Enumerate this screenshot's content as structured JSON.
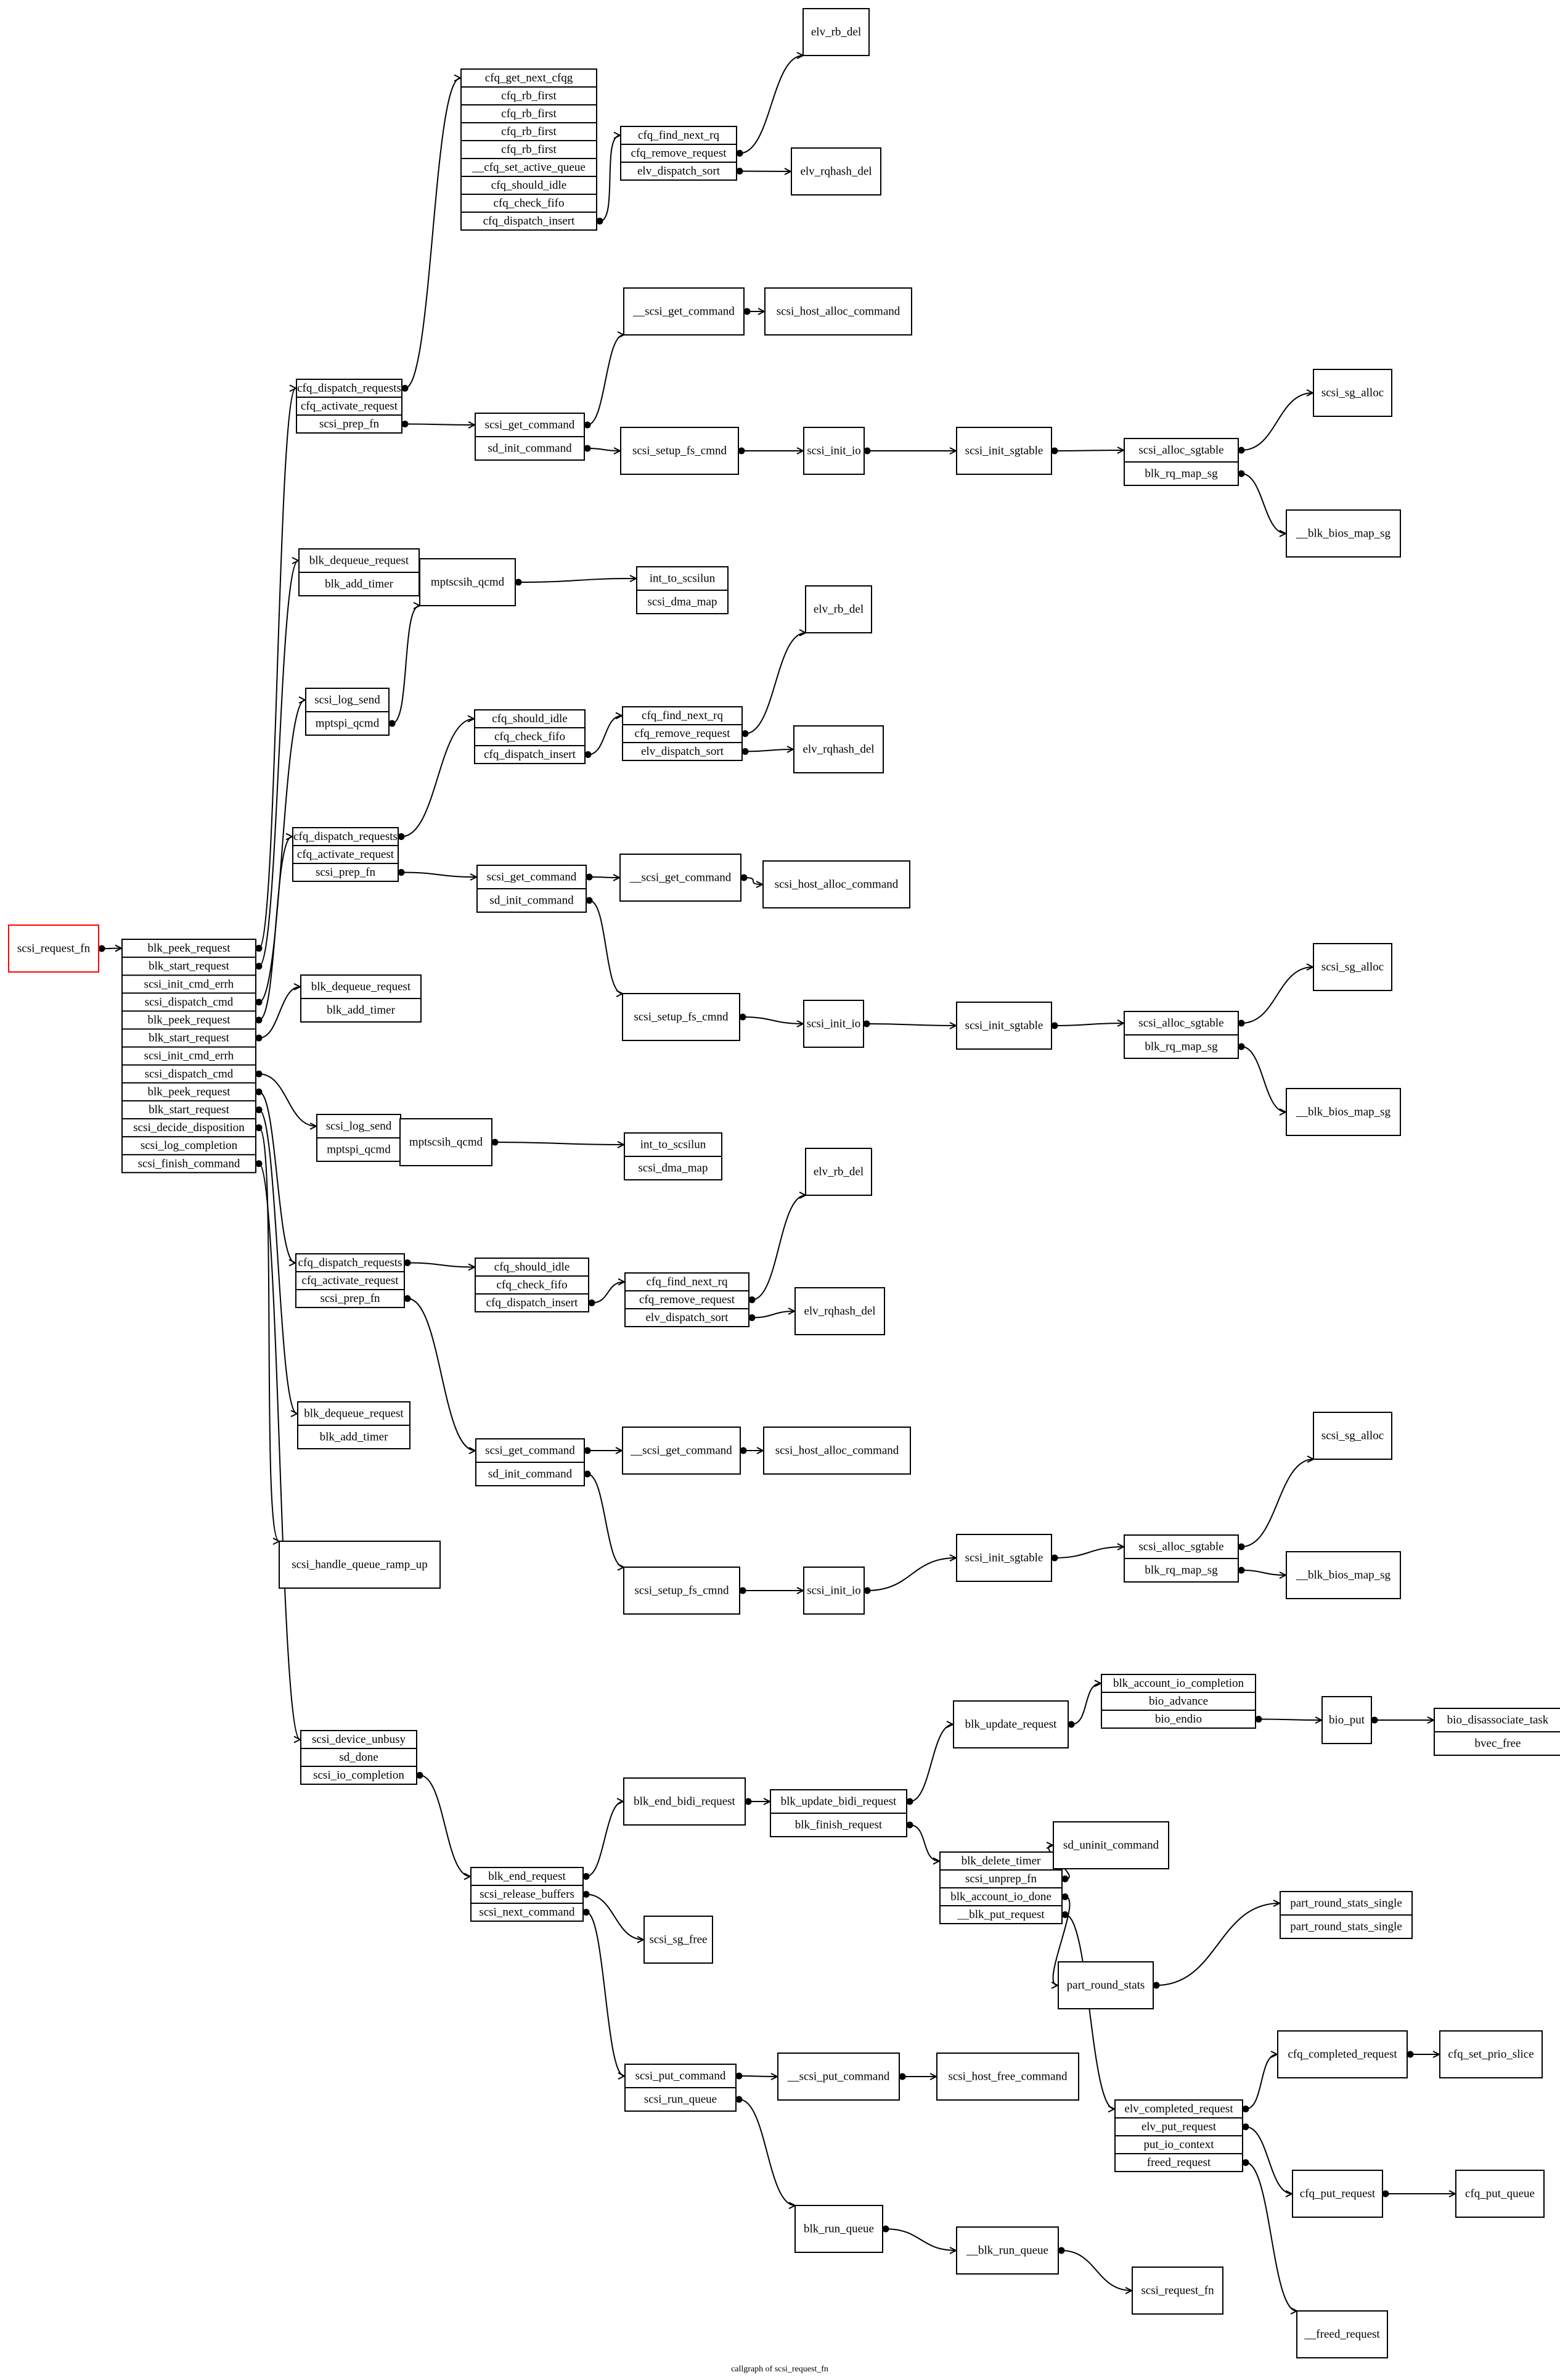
{
  "caption": "callgraph of scsi_request_fn",
  "nodes": [
    {
      "id": "root",
      "root": true,
      "rows": [
        "scsi_request_fn"
      ]
    },
    {
      "id": "main",
      "rows": [
        "blk_peek_request",
        "blk_start_request",
        "scsi_init_cmd_errh",
        "scsi_dispatch_cmd",
        "blk_peek_request",
        "blk_start_request",
        "scsi_init_cmd_errh",
        "scsi_dispatch_cmd",
        "blk_peek_request",
        "blk_start_request",
        "scsi_decide_disposition",
        "scsi_log_completion",
        "scsi_finish_command"
      ]
    },
    {
      "id": "cfqsel1",
      "rows": [
        "cfq_get_next_cfqg",
        "cfq_rb_first",
        "cfq_rb_first",
        "cfq_rb_first",
        "cfq_rb_first",
        "__cfq_set_active_queue",
        "cfq_should_idle",
        "cfq_check_fifo",
        "cfq_dispatch_insert"
      ]
    },
    {
      "id": "findnext1",
      "rows": [
        "cfq_find_next_rq",
        "cfq_remove_request",
        "elv_dispatch_sort"
      ]
    },
    {
      "id": "rbdel1",
      "rows": [
        "elv_rb_del"
      ]
    },
    {
      "id": "rqhash1",
      "rows": [
        "elv_rqhash_del"
      ]
    },
    {
      "id": "dispreq1",
      "rows": [
        "cfq_dispatch_requests",
        "cfq_activate_request",
        "scsi_prep_fn"
      ]
    },
    {
      "id": "getcmd1",
      "rows": [
        "scsi_get_command",
        "sd_init_command"
      ]
    },
    {
      "id": "__getcmd1",
      "rows": [
        "__scsi_get_command"
      ]
    },
    {
      "id": "hostalloc1",
      "rows": [
        "scsi_host_alloc_command"
      ]
    },
    {
      "id": "setupfs1",
      "rows": [
        "scsi_setup_fs_cmnd"
      ]
    },
    {
      "id": "initio1",
      "rows": [
        "scsi_init_io"
      ]
    },
    {
      "id": "initsg1",
      "rows": [
        "scsi_init_sgtable"
      ]
    },
    {
      "id": "allocsg1",
      "rows": [
        "scsi_alloc_sgtable",
        "blk_rq_map_sg"
      ]
    },
    {
      "id": "sgalloc1",
      "rows": [
        "scsi_sg_alloc"
      ]
    },
    {
      "id": "biosmap1",
      "rows": [
        "__blk_bios_map_sg"
      ]
    },
    {
      "id": "dequeue1",
      "rows": [
        "blk_dequeue_request",
        "blk_add_timer"
      ]
    },
    {
      "id": "logsend1",
      "rows": [
        "scsi_log_send",
        "mptspi_qcmd"
      ]
    },
    {
      "id": "mptqcmd1",
      "rows": [
        "mptscsih_qcmd"
      ]
    },
    {
      "id": "int2lun1",
      "rows": [
        "int_to_scsilun",
        "scsi_dma_map"
      ]
    },
    {
      "id": "cfqidle2",
      "rows": [
        "cfq_should_idle",
        "cfq_check_fifo",
        "cfq_dispatch_insert"
      ]
    },
    {
      "id": "findnext2",
      "rows": [
        "cfq_find_next_rq",
        "cfq_remove_request",
        "elv_dispatch_sort"
      ]
    },
    {
      "id": "rbdel2",
      "rows": [
        "elv_rb_del"
      ]
    },
    {
      "id": "rqhash2",
      "rows": [
        "elv_rqhash_del"
      ]
    },
    {
      "id": "dispreq2",
      "rows": [
        "cfq_dispatch_requests",
        "cfq_activate_request",
        "scsi_prep_fn"
      ]
    },
    {
      "id": "getcmd2",
      "rows": [
        "scsi_get_command",
        "sd_init_command"
      ]
    },
    {
      "id": "__getcmd2",
      "rows": [
        "__scsi_get_command"
      ]
    },
    {
      "id": "hostalloc2",
      "rows": [
        "scsi_host_alloc_command"
      ]
    },
    {
      "id": "setupfs2",
      "rows": [
        "scsi_setup_fs_cmnd"
      ]
    },
    {
      "id": "initio2",
      "rows": [
        "scsi_init_io"
      ]
    },
    {
      "id": "initsg2",
      "rows": [
        "scsi_init_sgtable"
      ]
    },
    {
      "id": "allocsg2",
      "rows": [
        "scsi_alloc_sgtable",
        "blk_rq_map_sg"
      ]
    },
    {
      "id": "sgalloc2",
      "rows": [
        "scsi_sg_alloc"
      ]
    },
    {
      "id": "biosmap2",
      "rows": [
        "__blk_bios_map_sg"
      ]
    },
    {
      "id": "dequeue2",
      "rows": [
        "blk_dequeue_request",
        "blk_add_timer"
      ]
    },
    {
      "id": "logsend2",
      "rows": [
        "scsi_log_send",
        "mptspi_qcmd"
      ]
    },
    {
      "id": "mptqcmd2",
      "rows": [
        "mptscsih_qcmd"
      ]
    },
    {
      "id": "int2lun2",
      "rows": [
        "int_to_scsilun",
        "scsi_dma_map"
      ]
    },
    {
      "id": "rbdel3",
      "rows": [
        "elv_rb_del"
      ]
    },
    {
      "id": "dispreq3",
      "rows": [
        "cfq_dispatch_requests",
        "cfq_activate_request",
        "scsi_prep_fn"
      ]
    },
    {
      "id": "cfqidle3",
      "rows": [
        "cfq_should_idle",
        "cfq_check_fifo",
        "cfq_dispatch_insert"
      ]
    },
    {
      "id": "findnext3",
      "rows": [
        "cfq_find_next_rq",
        "cfq_remove_request",
        "elv_dispatch_sort"
      ]
    },
    {
      "id": "rqhash3",
      "rows": [
        "elv_rqhash_del"
      ]
    },
    {
      "id": "dequeue3",
      "rows": [
        "blk_dequeue_request",
        "blk_add_timer"
      ]
    },
    {
      "id": "getcmd3",
      "rows": [
        "scsi_get_command",
        "sd_init_command"
      ]
    },
    {
      "id": "__getcmd3",
      "rows": [
        "__scsi_get_command"
      ]
    },
    {
      "id": "hostalloc3",
      "rows": [
        "scsi_host_alloc_command"
      ]
    },
    {
      "id": "sgalloc3",
      "rows": [
        "scsi_sg_alloc"
      ]
    },
    {
      "id": "initsg3",
      "rows": [
        "scsi_init_sgtable"
      ]
    },
    {
      "id": "allocsg3",
      "rows": [
        "scsi_alloc_sgtable",
        "blk_rq_map_sg"
      ]
    },
    {
      "id": "biosmap3",
      "rows": [
        "__blk_bios_map_sg"
      ]
    },
    {
      "id": "rampup",
      "rows": [
        "scsi_handle_queue_ramp_up"
      ]
    },
    {
      "id": "setupfs3",
      "rows": [
        "scsi_setup_fs_cmnd"
      ]
    },
    {
      "id": "initio3",
      "rows": [
        "scsi_init_io"
      ]
    },
    {
      "id": "unbusy",
      "rows": [
        "scsi_device_unbusy",
        "sd_done",
        "scsi_io_completion"
      ]
    },
    {
      "id": "endbidi",
      "rows": [
        "blk_end_bidi_request"
      ]
    },
    {
      "id": "updbidi",
      "rows": [
        "blk_update_bidi_request",
        "blk_finish_request"
      ]
    },
    {
      "id": "updreq",
      "rows": [
        "blk_update_request"
      ]
    },
    {
      "id": "acctcomp",
      "rows": [
        "blk_account_io_completion",
        "bio_advance",
        "bio_endio"
      ]
    },
    {
      "id": "bioput",
      "rows": [
        "bio_put"
      ]
    },
    {
      "id": "biodisassoc",
      "rows": [
        "bio_disassociate_task",
        "bvec_free"
      ]
    },
    {
      "id": "deltimer",
      "rows": [
        "blk_delete_timer",
        "scsi_unprep_fn",
        "blk_account_io_done",
        "__blk_put_request"
      ]
    },
    {
      "id": "uninit",
      "rows": [
        "sd_uninit_command"
      ]
    },
    {
      "id": "prss",
      "rows": [
        "part_round_stats_single",
        "part_round_stats_single"
      ]
    },
    {
      "id": "prs",
      "rows": [
        "part_round_stats"
      ]
    },
    {
      "id": "endreq",
      "rows": [
        "blk_end_request",
        "scsi_release_buffers",
        "scsi_next_command"
      ]
    },
    {
      "id": "sgfree",
      "rows": [
        "scsi_sg_free"
      ]
    },
    {
      "id": "putcmd",
      "rows": [
        "scsi_put_command",
        "scsi_run_queue"
      ]
    },
    {
      "id": "__putcmd",
      "rows": [
        "__scsi_put_command"
      ]
    },
    {
      "id": "hostfree",
      "rows": [
        "scsi_host_free_command"
      ]
    },
    {
      "id": "cfqcompl",
      "rows": [
        "cfq_completed_request"
      ]
    },
    {
      "id": "prioslice",
      "rows": [
        "cfq_set_prio_slice"
      ]
    },
    {
      "id": "elvcompl",
      "rows": [
        "elv_completed_request",
        "elv_put_request",
        "put_io_context",
        "freed_request"
      ]
    },
    {
      "id": "cfqputreq",
      "rows": [
        "cfq_put_request"
      ]
    },
    {
      "id": "cfqputq",
      "rows": [
        "cfq_put_queue"
      ]
    },
    {
      "id": "blkrunq",
      "rows": [
        "blk_run_queue"
      ]
    },
    {
      "id": "__blkrunq",
      "rows": [
        "__blk_run_queue"
      ]
    },
    {
      "id": "reqfn2",
      "rows": [
        "scsi_request_fn"
      ]
    },
    {
      "id": "freedreq",
      "rows": [
        "__freed_request"
      ]
    }
  ],
  "edges": [
    {
      "from": "root.0",
      "to": "main"
    },
    {
      "from": "main.0",
      "to": "dispreq1"
    },
    {
      "from": "main.1",
      "to": "dequeue1"
    },
    {
      "from": "main.3",
      "to": "logsend1"
    },
    {
      "from": "main.4",
      "to": "dispreq2"
    },
    {
      "from": "main.5",
      "to": "dequeue2"
    },
    {
      "from": "main.7",
      "to": "logsend2"
    },
    {
      "from": "main.8",
      "to": "dispreq3"
    },
    {
      "from": "main.9",
      "to": "dequeue3"
    },
    {
      "from": "main.10",
      "to": "rampup"
    },
    {
      "from": "main.12",
      "to": "unbusy"
    },
    {
      "from": "dispreq1.0",
      "to": "cfqsel1"
    },
    {
      "from": "cfqsel1.8",
      "to": "findnext1"
    },
    {
      "from": "findnext1.1",
      "to": "rbdel1"
    },
    {
      "from": "findnext1.2",
      "to": "rqhash1"
    },
    {
      "from": "dispreq1.2",
      "to": "getcmd1"
    },
    {
      "from": "getcmd1.0",
      "to": "__getcmd1"
    },
    {
      "from": "__getcmd1.0",
      "to": "hostalloc1"
    },
    {
      "from": "getcmd1.1",
      "to": "setupfs1"
    },
    {
      "from": "setupfs1.0",
      "to": "initio1"
    },
    {
      "from": "initio1.0",
      "to": "initsg1"
    },
    {
      "from": "initsg1.0",
      "to": "allocsg1"
    },
    {
      "from": "allocsg1.0",
      "to": "sgalloc1"
    },
    {
      "from": "allocsg1.1",
      "to": "biosmap1"
    },
    {
      "from": "logsend1.1",
      "to": "mptqcmd1"
    },
    {
      "from": "mptqcmd1.0",
      "to": "int2lun1"
    },
    {
      "from": "dispreq2.0",
      "to": "cfqidle2"
    },
    {
      "from": "cfqidle2.2",
      "to": "findnext2"
    },
    {
      "from": "findnext2.1",
      "to": "rbdel2"
    },
    {
      "from": "findnext2.2",
      "to": "rqhash2"
    },
    {
      "from": "dispreq2.2",
      "to": "getcmd2"
    },
    {
      "from": "getcmd2.0",
      "to": "__getcmd2"
    },
    {
      "from": "__getcmd2.0",
      "to": "hostalloc2"
    },
    {
      "from": "getcmd2.1",
      "to": "setupfs2"
    },
    {
      "from": "setupfs2.0",
      "to": "initio2"
    },
    {
      "from": "initio2.0",
      "to": "initsg2"
    },
    {
      "from": "initsg2.0",
      "to": "allocsg2"
    },
    {
      "from": "allocsg2.0",
      "to": "sgalloc2"
    },
    {
      "from": "allocsg2.1",
      "to": "biosmap2"
    },
    {
      "from": "logsend2.1",
      "to": "mptqcmd2"
    },
    {
      "from": "mptqcmd2.0",
      "to": "int2lun2"
    },
    {
      "from": "dispreq3.0",
      "to": "cfqidle3"
    },
    {
      "from": "cfqidle3.2",
      "to": "findnext3"
    },
    {
      "from": "findnext3.1",
      "to": "rbdel3"
    },
    {
      "from": "findnext3.2",
      "to": "rqhash3"
    },
    {
      "from": "dispreq3.2",
      "to": "getcmd3"
    },
    {
      "from": "getcmd3.0",
      "to": "__getcmd3"
    },
    {
      "from": "__getcmd3.0",
      "to": "hostalloc3"
    },
    {
      "from": "getcmd3.1",
      "to": "setupfs3"
    },
    {
      "from": "setupfs3.0",
      "to": "initio3"
    },
    {
      "from": "initio3.0",
      "to": "initsg3"
    },
    {
      "from": "initsg3.0",
      "to": "allocsg3"
    },
    {
      "from": "allocsg3.0",
      "to": "sgalloc3"
    },
    {
      "from": "allocsg3.1",
      "to": "biosmap3"
    },
    {
      "from": "unbusy.2",
      "to": "endreq"
    },
    {
      "from": "endreq.0",
      "to": "endbidi"
    },
    {
      "from": "endreq.1",
      "to": "sgfree"
    },
    {
      "from": "endreq.2",
      "to": "putcmd"
    },
    {
      "from": "endbidi.0",
      "to": "updbidi"
    },
    {
      "from": "updbidi.0",
      "to": "updreq"
    },
    {
      "from": "updbidi.1",
      "to": "deltimer"
    },
    {
      "from": "updreq.0",
      "to": "acctcomp"
    },
    {
      "from": "acctcomp.2",
      "to": "bioput"
    },
    {
      "from": "bioput.0",
      "to": "biodisassoc"
    },
    {
      "from": "deltimer.1",
      "to": "uninit"
    },
    {
      "from": "deltimer.2",
      "to": "prs"
    },
    {
      "from": "deltimer.3",
      "to": "elvcompl"
    },
    {
      "from": "prs.0",
      "to": "prss"
    },
    {
      "from": "putcmd.0",
      "to": "__putcmd"
    },
    {
      "from": "__putcmd.0",
      "to": "hostfree"
    },
    {
      "from": "putcmd.1",
      "to": "blkrunq"
    },
    {
      "from": "blkrunq.0",
      "to": "__blkrunq"
    },
    {
      "from": "__blkrunq.0",
      "to": "reqfn2"
    },
    {
      "from": "elvcompl.0",
      "to": "cfqcompl"
    },
    {
      "from": "cfqcompl.0",
      "to": "prioslice"
    },
    {
      "from": "elvcompl.1",
      "to": "cfqputreq"
    },
    {
      "from": "cfqputreq.0",
      "to": "cfqputq"
    },
    {
      "from": "elvcompl.3",
      "to": "freedreq"
    }
  ]
}
